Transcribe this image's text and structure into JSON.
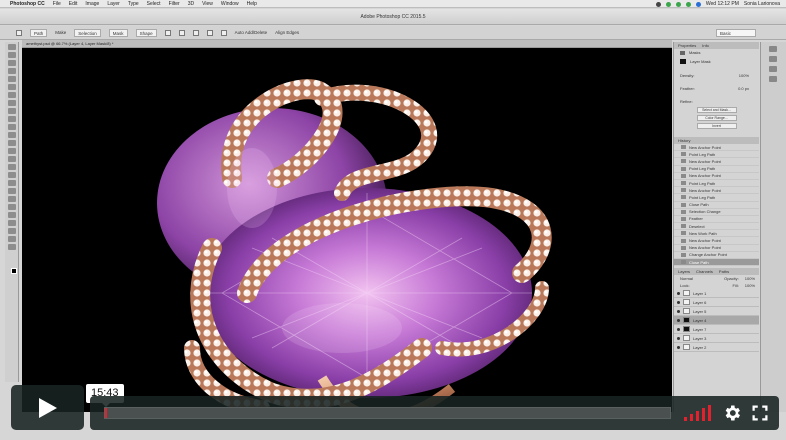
{
  "menubar": {
    "items": [
      "Photoshop CC",
      "File",
      "Edit",
      "Image",
      "Layer",
      "Type",
      "Select",
      "Filter",
      "3D",
      "View",
      "Window",
      "Help"
    ],
    "clock": "Wed 12:12 PM",
    "user": "Sonia Larionova"
  },
  "window": {
    "title": "Adobe Photoshop CC 2015.5"
  },
  "options": {
    "path_mode": "Path",
    "make_label": "Make",
    "selection_label": "Selection",
    "mask_label": "Mask",
    "shape_label": "Shape",
    "auto_add_delete": "Auto Add/Delete",
    "align_edges": "Align Edges",
    "workspace": "Basic"
  },
  "document": {
    "tab": "amethyst.psd @ 66.7% (Layer 4, Layer Mask/8) *"
  },
  "properties": {
    "tabs": [
      "Properties",
      "Info"
    ],
    "section": "Masks",
    "layer_mask": "Layer Mask",
    "density_label": "Density:",
    "density_value": "100%",
    "feather_label": "Feather:",
    "feather_value": "0.0 px",
    "refine_label": "Refine:",
    "select_mask_button": "Select and Mask...",
    "color_range_button": "Color Range...",
    "invert_button": "Invert"
  },
  "history": {
    "title": "History",
    "items": [
      "New Anchor Point",
      "Point Leg Path",
      "New Anchor Point",
      "Point Leg Path",
      "New Anchor Point",
      "Point Leg Path",
      "New Anchor Point",
      "Point Leg Path",
      "Close Path",
      "Selection Change",
      "Feather",
      "Deselect",
      "New Work Path",
      "New Anchor Point",
      "New Anchor Point",
      "Change Anchor Point",
      "Close Path"
    ]
  },
  "layers": {
    "tabs": [
      "Layers",
      "Channels",
      "Paths"
    ],
    "blend_mode": "Normal",
    "opacity_label": "Opacity:",
    "opacity_value": "100%",
    "fill_label": "Fill:",
    "fill_value": "100%",
    "lock_label": "Lock:",
    "rows": [
      {
        "name": "Layer 1",
        "dark": false,
        "active": false
      },
      {
        "name": "Layer 6",
        "dark": false,
        "active": false
      },
      {
        "name": "Layer 5",
        "dark": false,
        "active": false
      },
      {
        "name": "Layer 4",
        "dark": true,
        "active": true
      },
      {
        "name": "Layer 7",
        "dark": true,
        "active": false
      },
      {
        "name": "Layer 3",
        "dark": false,
        "active": false
      },
      {
        "name": "Layer 2",
        "dark": false,
        "active": false
      }
    ]
  },
  "player": {
    "timecode": "15:43",
    "progress": 0.0,
    "buffered": 0.0,
    "accent": "#00adef",
    "head_color": "#e2212f"
  }
}
